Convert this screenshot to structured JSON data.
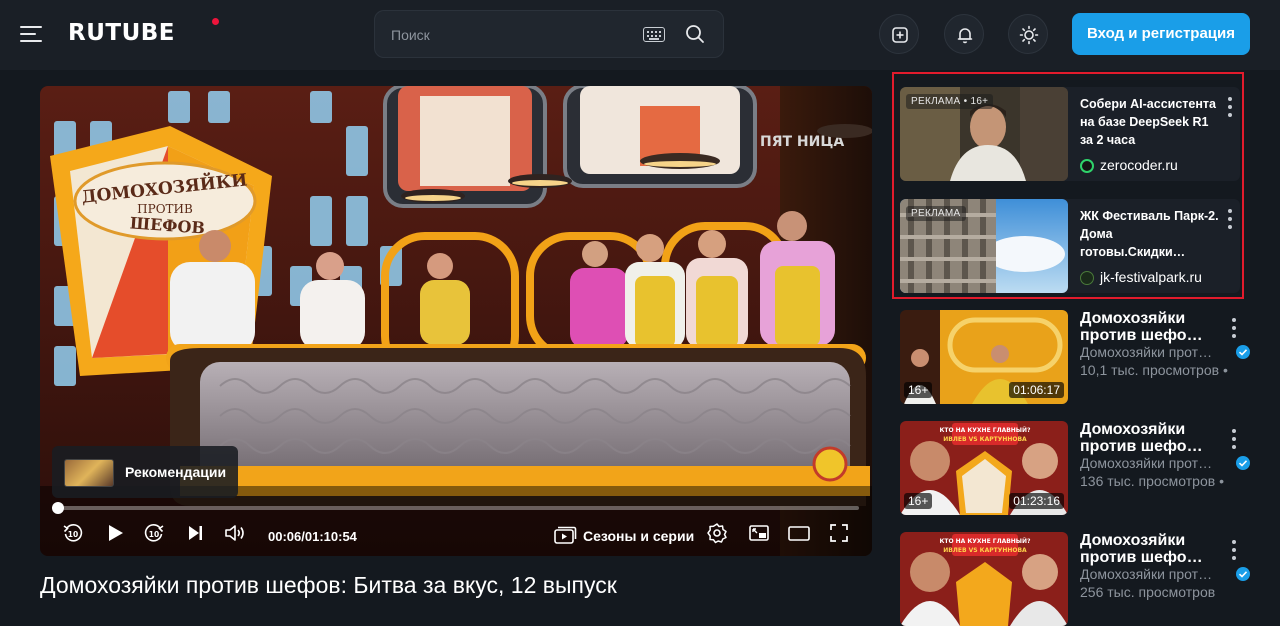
{
  "header": {
    "logo_text": "RUTUBE",
    "search_placeholder": "Поиск",
    "login_label": "Вход и регистрация",
    "icons": [
      "menu-icon",
      "keyboard-icon",
      "search-icon",
      "add-video-icon",
      "bell-icon",
      "theme-sun-icon"
    ],
    "accent_color": "#1a9ee8",
    "logo_dot_color": "#ed143b"
  },
  "player": {
    "recommendations_label": "Рекомендации",
    "time_current": "00:06",
    "time_separator": "/",
    "time_total": "01:10:54",
    "progress_fraction": 0.0014,
    "seasons_label": "Сезоны и серии",
    "scene_texts": {
      "sign_line1": "ДОМОХОЗЯЙКИ",
      "sign_line2": "ПРОТИВ",
      "sign_line3": "ШЕФОВ",
      "channel_mark": "ПЯТ НИЦА"
    }
  },
  "video_title": "Домохозяйки против шефов: Битва за вкус, 12 выпуск",
  "ads": [
    {
      "tag": "РЕКЛАМА • 16+",
      "title": "Собери AI-ассистента на базе DeepSeek R1 за 2 часа",
      "domain": "zerocoder.ru"
    },
    {
      "tag": "РЕКЛАМА",
      "title": "ЖК Фестиваль Парк-2. Дома готовы.Скидки…",
      "domain": "jk-festivalpark.ru"
    }
  ],
  "recommendations": [
    {
      "title": "Домохозяйки против шефо…",
      "channel": "Домохозяйки прот…",
      "views": "10,1 тыс. просмотров  •",
      "age": "16+",
      "duration": "01:06:17"
    },
    {
      "title": "Домохозяйки против шефо…",
      "channel": "Домохозяйки прот…",
      "views": "136 тыс. просмотров  •",
      "age": "16+",
      "duration": "01:23:16",
      "thumb_banner": "КТО НА КУХНЕ ГЛАВНЫЙ? ИВЛЕВ VS КАРТУННОВА"
    },
    {
      "title": "Домохозяйки против шефо…",
      "channel": "Домохозяйки прот…",
      "views": "256 тыс. просмотров",
      "thumb_banner": "КТО НА КУХНЕ ГЛАВНЫЙ? ИВЛЕВ VS КАРТУННОВА"
    }
  ]
}
